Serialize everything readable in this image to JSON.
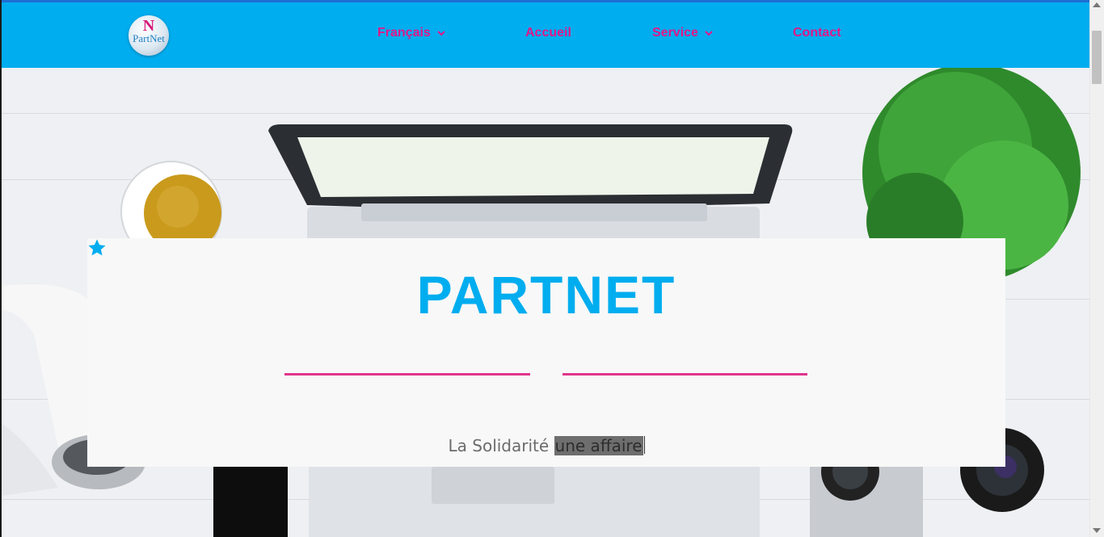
{
  "header": {
    "logo_text": "PartNet",
    "logo_mark": "N",
    "nav": [
      {
        "label": "Français",
        "has_dropdown": true
      },
      {
        "label": "Accueil",
        "has_dropdown": false
      },
      {
        "label": "Service",
        "has_dropdown": true
      },
      {
        "label": "Contact",
        "has_dropdown": false
      }
    ]
  },
  "hero": {
    "title": "PARTNET",
    "divider_icon": "star-icon",
    "tagline_plain": "La Solidarité ",
    "tagline_selected": "une affaire"
  },
  "colors": {
    "header_bg": "#00adef",
    "nav_text": "#e0188a",
    "title": "#00adef",
    "divider": "#e0358b",
    "card_bg": "#f8f8f8"
  }
}
